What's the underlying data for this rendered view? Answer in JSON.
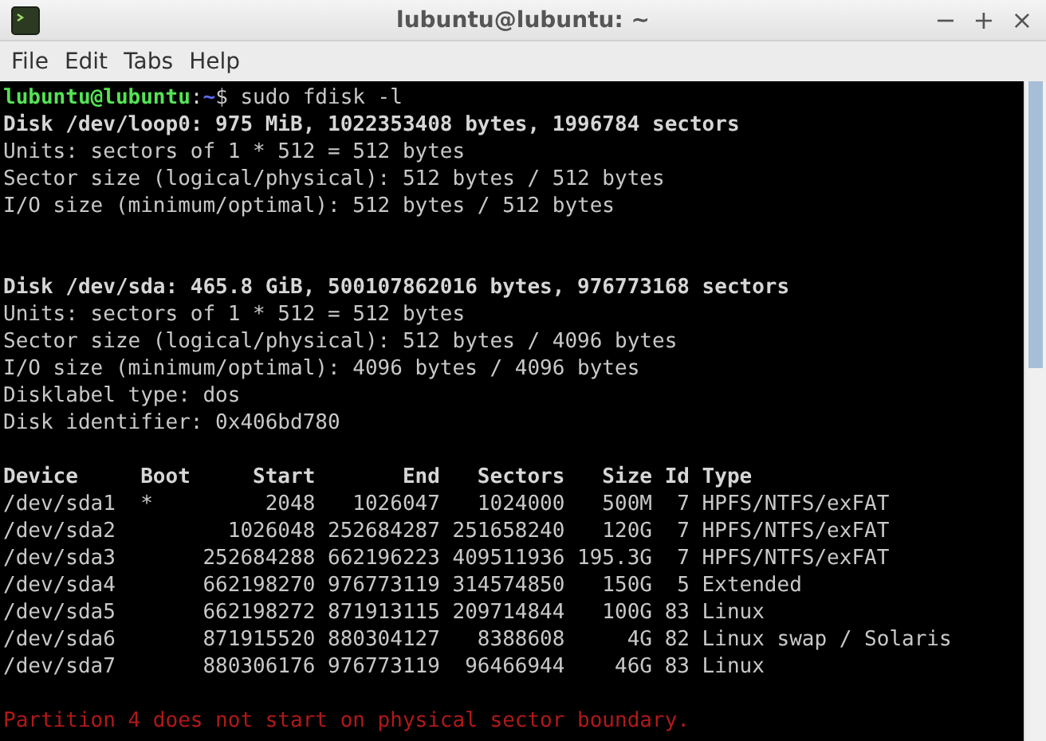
{
  "window": {
    "title": "lubuntu@lubuntu: ~",
    "controls": [
      "−",
      "+",
      "×"
    ]
  },
  "menu": [
    "File",
    "Edit",
    "Tabs",
    "Help"
  ],
  "terminal": {
    "prompt": {
      "user": "lubuntu@lubuntu",
      "separator": ":",
      "path": "~",
      "command": "$ sudo fdisk -l"
    },
    "lines": [
      {
        "kind": "bold",
        "text": "Disk /dev/loop0: 975 MiB, 1022353408 bytes, 1996784 sectors"
      },
      {
        "kind": "normal",
        "text": "Units: sectors of 1 * 512 = 512 bytes"
      },
      {
        "kind": "normal",
        "text": "Sector size (logical/physical): 512 bytes / 512 bytes"
      },
      {
        "kind": "normal",
        "text": "I/O size (minimum/optimal): 512 bytes / 512 bytes"
      },
      {
        "kind": "blank"
      },
      {
        "kind": "blank"
      },
      {
        "kind": "bold",
        "text": "Disk /dev/sda: 465.8 GiB, 500107862016 bytes, 976773168 sectors"
      },
      {
        "kind": "normal",
        "text": "Units: sectors of 1 * 512 = 512 bytes"
      },
      {
        "kind": "normal",
        "text": "Sector size (logical/physical): 512 bytes / 4096 bytes"
      },
      {
        "kind": "normal",
        "text": "I/O size (minimum/optimal): 4096 bytes / 4096 bytes"
      },
      {
        "kind": "normal",
        "text": "Disklabel type: dos"
      },
      {
        "kind": "normal",
        "text": "Disk identifier: 0x406bd780"
      },
      {
        "kind": "blank"
      },
      {
        "kind": "bold",
        "text": "Device     Boot     Start       End   Sectors   Size Id Type"
      },
      {
        "kind": "normal",
        "text": "/dev/sda1  *         2048   1026047   1024000   500M  7 HPFS/NTFS/exFAT"
      },
      {
        "kind": "normal",
        "text": "/dev/sda2         1026048 252684287 251658240   120G  7 HPFS/NTFS/exFAT"
      },
      {
        "kind": "normal",
        "text": "/dev/sda3       252684288 662196223 409511936 195.3G  7 HPFS/NTFS/exFAT"
      },
      {
        "kind": "normal",
        "text": "/dev/sda4       662198270 976773119 314574850   150G  5 Extended"
      },
      {
        "kind": "normal",
        "text": "/dev/sda5       662198272 871913115 209714844   100G 83 Linux"
      },
      {
        "kind": "normal",
        "text": "/dev/sda6       871915520 880304127   8388608     4G 82 Linux swap / Solaris"
      },
      {
        "kind": "normal",
        "text": "/dev/sda7       880306176 976773119  96466944    46G 83 Linux"
      },
      {
        "kind": "blank"
      },
      {
        "kind": "error",
        "text": "Partition 4 does not start on physical sector boundary."
      }
    ]
  }
}
